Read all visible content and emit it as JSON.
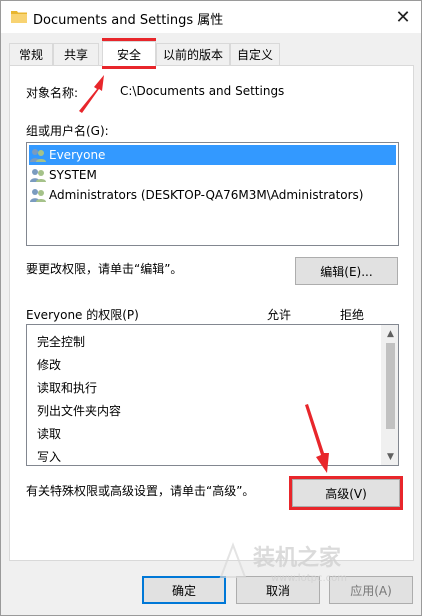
{
  "window": {
    "title": "Documents and Settings 属性",
    "close_glyph": "✕"
  },
  "tabs": [
    {
      "label": "常规"
    },
    {
      "label": "共享"
    },
    {
      "label": "安全"
    },
    {
      "label": "以前的版本"
    },
    {
      "label": "自定义"
    }
  ],
  "object": {
    "label": "对象名称:",
    "value": "C:\\Documents and Settings"
  },
  "groups": {
    "label": "组或用户名(G):",
    "items": [
      {
        "name": "Everyone",
        "selected": true
      },
      {
        "name": "SYSTEM",
        "selected": false
      },
      {
        "name": "Administrators (DESKTOP-QA76M3M\\Administrators)",
        "selected": false
      }
    ]
  },
  "edit": {
    "hint": "要更改权限，请单击“编辑”。",
    "button": "编辑(E)..."
  },
  "permissions": {
    "title": "Everyone 的权限(P)",
    "allow_header": "允许",
    "deny_header": "拒绝",
    "items": [
      "完全控制",
      "修改",
      "读取和执行",
      "列出文件夹内容",
      "读取",
      "写入"
    ]
  },
  "advanced": {
    "hint": "有关特殊权限或高级设置，请单击“高级”。",
    "button": "高级(V)"
  },
  "footer": {
    "ok": "确定",
    "cancel": "取消",
    "apply": "应用(A)"
  },
  "watermark": {
    "text": "装机之家",
    "url": "www.lotpc.com"
  },
  "colors": {
    "accent": "#0078d7",
    "selection": "#3399ff",
    "annotation_red": "#e8262b"
  }
}
